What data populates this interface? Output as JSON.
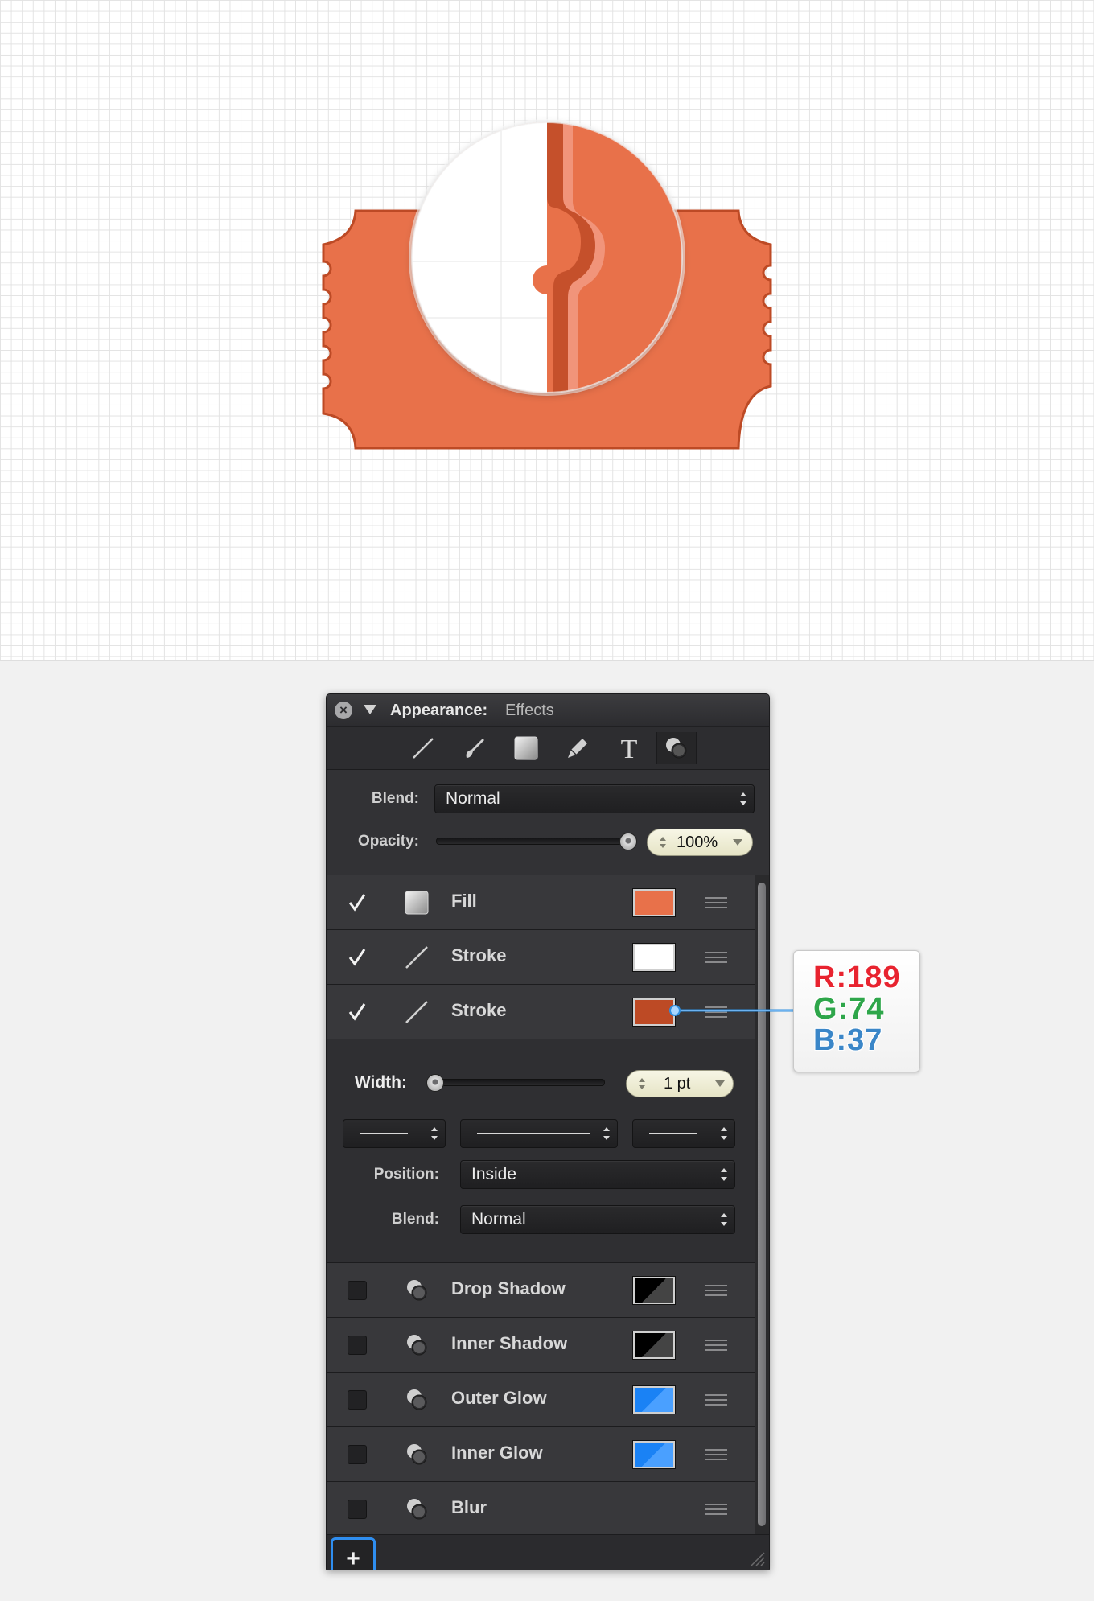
{
  "panel": {
    "title": "Appearance:",
    "subtitle": "Effects",
    "close_icon": "close-icon",
    "tools": [
      "stroke-tool-icon",
      "brush-tool-icon",
      "fill-tool-icon",
      "pen-tool-icon",
      "text-tool-icon",
      "effects-tool-icon"
    ],
    "blend_label": "Blend:",
    "blend_value": "Normal",
    "opacity_label": "Opacity:",
    "opacity_value": "100%",
    "opacity_level": 1.0,
    "layers": [
      {
        "checked": true,
        "name": "Fill",
        "icon": "fill-icon",
        "color": "#e8714a"
      },
      {
        "checked": true,
        "name": "Stroke",
        "icon": "stroke-icon",
        "color": "#ffffff"
      },
      {
        "checked": true,
        "name": "Stroke",
        "icon": "stroke-icon",
        "color": "#bd4a25"
      }
    ],
    "stroke_settings": {
      "width_label": "Width:",
      "width_value": "1 pt",
      "width_level": 0.0,
      "position_label": "Position:",
      "position_value": "Inside",
      "blend_label": "Blend:",
      "blend_value": "Normal"
    },
    "effects": [
      {
        "checked": false,
        "name": "Drop Shadow",
        "icon": "shadow-icon",
        "swatch": "black"
      },
      {
        "checked": false,
        "name": "Inner Shadow",
        "icon": "shadow-icon",
        "swatch": "black"
      },
      {
        "checked": false,
        "name": "Outer Glow",
        "icon": "shadow-icon",
        "swatch": "blue"
      },
      {
        "checked": false,
        "name": "Inner Glow",
        "icon": "shadow-icon",
        "swatch": "blue"
      },
      {
        "checked": false,
        "name": "Blur",
        "icon": "shadow-icon",
        "swatch": ""
      }
    ],
    "add_button": "+"
  },
  "callout": {
    "r": "R:189",
    "g": "G:74",
    "b": "B:37",
    "r_color": "#e8232f",
    "g_color": "#2ea64a",
    "b_color": "#3a86c8"
  },
  "artwork": {
    "ticket_color": "#e8714a",
    "ticket_stroke": "#bd4a25",
    "badge_fill": "#ffffff"
  }
}
